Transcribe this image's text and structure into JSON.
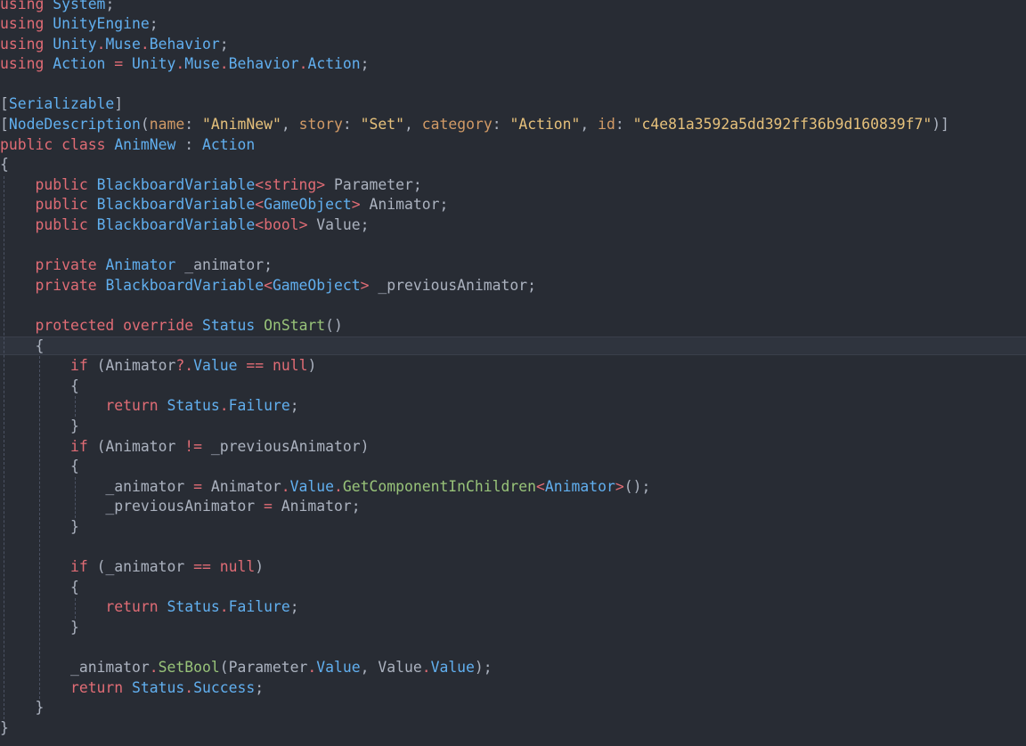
{
  "editor": {
    "lines": [
      [
        {
          "t": "using",
          "c": "kw"
        },
        {
          "t": " ",
          "c": "pn"
        },
        {
          "t": "System",
          "c": "ty"
        },
        {
          "t": ";",
          "c": "pn"
        }
      ],
      [
        {
          "t": "using",
          "c": "kw"
        },
        {
          "t": " ",
          "c": "pn"
        },
        {
          "t": "UnityEngine",
          "c": "ty"
        },
        {
          "t": ";",
          "c": "pn"
        }
      ],
      [
        {
          "t": "using",
          "c": "kw"
        },
        {
          "t": " ",
          "c": "pn"
        },
        {
          "t": "Unity",
          "c": "ty"
        },
        {
          "t": ".",
          "c": "op"
        },
        {
          "t": "Muse",
          "c": "ty"
        },
        {
          "t": ".",
          "c": "op"
        },
        {
          "t": "Behavior",
          "c": "ty"
        },
        {
          "t": ";",
          "c": "pn"
        }
      ],
      [
        {
          "t": "using",
          "c": "kw"
        },
        {
          "t": " ",
          "c": "pn"
        },
        {
          "t": "Action",
          "c": "ty"
        },
        {
          "t": " = ",
          "c": "op"
        },
        {
          "t": "Unity",
          "c": "ty"
        },
        {
          "t": ".",
          "c": "op"
        },
        {
          "t": "Muse",
          "c": "ty"
        },
        {
          "t": ".",
          "c": "op"
        },
        {
          "t": "Behavior",
          "c": "ty"
        },
        {
          "t": ".",
          "c": "op"
        },
        {
          "t": "Action",
          "c": "ty"
        },
        {
          "t": ";",
          "c": "pn"
        }
      ],
      [],
      [
        {
          "t": "[",
          "c": "pn"
        },
        {
          "t": "Serializable",
          "c": "at"
        },
        {
          "t": "]",
          "c": "pn"
        }
      ],
      [
        {
          "t": "[",
          "c": "pn"
        },
        {
          "t": "NodeDescription",
          "c": "at"
        },
        {
          "t": "(",
          "c": "pn"
        },
        {
          "t": "name",
          "c": "pm"
        },
        {
          "t": ": ",
          "c": "pn"
        },
        {
          "t": "\"AnimNew\"",
          "c": "st"
        },
        {
          "t": ", ",
          "c": "pn"
        },
        {
          "t": "story",
          "c": "pm"
        },
        {
          "t": ": ",
          "c": "pn"
        },
        {
          "t": "\"Set\"",
          "c": "st"
        },
        {
          "t": ", ",
          "c": "pn"
        },
        {
          "t": "category",
          "c": "pm"
        },
        {
          "t": ": ",
          "c": "pn"
        },
        {
          "t": "\"Action\"",
          "c": "st"
        },
        {
          "t": ", ",
          "c": "pn"
        },
        {
          "t": "id",
          "c": "pm"
        },
        {
          "t": ": ",
          "c": "pn"
        },
        {
          "t": "\"c4e81a3592a5dd392ff36b9d160839f7\"",
          "c": "st"
        },
        {
          "t": ")]",
          "c": "pn"
        }
      ],
      [
        {
          "t": "public",
          "c": "kw"
        },
        {
          "t": " ",
          "c": "pn"
        },
        {
          "t": "class",
          "c": "kw"
        },
        {
          "t": " ",
          "c": "pn"
        },
        {
          "t": "AnimNew",
          "c": "ty"
        },
        {
          "t": " : ",
          "c": "pn"
        },
        {
          "t": "Action",
          "c": "ty"
        }
      ],
      [
        {
          "t": "{",
          "c": "pn"
        }
      ],
      [
        {
          "t": "    ",
          "c": "pn"
        },
        {
          "t": "public",
          "c": "kw"
        },
        {
          "t": " ",
          "c": "pn"
        },
        {
          "t": "BlackboardVariable",
          "c": "ty"
        },
        {
          "t": "<",
          "c": "op"
        },
        {
          "t": "string",
          "c": "kw"
        },
        {
          "t": ">",
          "c": "op"
        },
        {
          "t": " Parameter;",
          "c": "pn"
        }
      ],
      [
        {
          "t": "    ",
          "c": "pn"
        },
        {
          "t": "public",
          "c": "kw"
        },
        {
          "t": " ",
          "c": "pn"
        },
        {
          "t": "BlackboardVariable",
          "c": "ty"
        },
        {
          "t": "<",
          "c": "op"
        },
        {
          "t": "GameObject",
          "c": "ty"
        },
        {
          "t": ">",
          "c": "op"
        },
        {
          "t": " Animator;",
          "c": "pn"
        }
      ],
      [
        {
          "t": "    ",
          "c": "pn"
        },
        {
          "t": "public",
          "c": "kw"
        },
        {
          "t": " ",
          "c": "pn"
        },
        {
          "t": "BlackboardVariable",
          "c": "ty"
        },
        {
          "t": "<",
          "c": "op"
        },
        {
          "t": "bool",
          "c": "kw"
        },
        {
          "t": ">",
          "c": "op"
        },
        {
          "t": " Value;",
          "c": "pn"
        }
      ],
      [],
      [
        {
          "t": "    ",
          "c": "pn"
        },
        {
          "t": "private",
          "c": "kw"
        },
        {
          "t": " ",
          "c": "pn"
        },
        {
          "t": "Animator",
          "c": "ty"
        },
        {
          "t": " _animator;",
          "c": "pn"
        }
      ],
      [
        {
          "t": "    ",
          "c": "pn"
        },
        {
          "t": "private",
          "c": "kw"
        },
        {
          "t": " ",
          "c": "pn"
        },
        {
          "t": "BlackboardVariable",
          "c": "ty"
        },
        {
          "t": "<",
          "c": "op"
        },
        {
          "t": "GameObject",
          "c": "ty"
        },
        {
          "t": ">",
          "c": "op"
        },
        {
          "t": " _previousAnimator;",
          "c": "pn"
        }
      ],
      [],
      [
        {
          "t": "    ",
          "c": "pn"
        },
        {
          "t": "protected",
          "c": "kw"
        },
        {
          "t": " ",
          "c": "pn"
        },
        {
          "t": "override",
          "c": "kw"
        },
        {
          "t": " ",
          "c": "pn"
        },
        {
          "t": "Status",
          "c": "ty"
        },
        {
          "t": " ",
          "c": "pn"
        },
        {
          "t": "OnStart",
          "c": "fn"
        },
        {
          "t": "()",
          "c": "pn"
        }
      ],
      [
        {
          "t": "    ",
          "c": "pn"
        },
        {
          "t": "{",
          "c": "pn"
        }
      ],
      [
        {
          "t": "        ",
          "c": "pn"
        },
        {
          "t": "if",
          "c": "kw"
        },
        {
          "t": " (Animator",
          "c": "pn"
        },
        {
          "t": "?.",
          "c": "op"
        },
        {
          "t": "Value",
          "c": "ty"
        },
        {
          "t": " == ",
          "c": "op"
        },
        {
          "t": "null",
          "c": "kw"
        },
        {
          "t": ")",
          "c": "pn"
        }
      ],
      [
        {
          "t": "        ",
          "c": "pn"
        },
        {
          "t": "{",
          "c": "pn"
        }
      ],
      [
        {
          "t": "            ",
          "c": "pn"
        },
        {
          "t": "return",
          "c": "kw"
        },
        {
          "t": " ",
          "c": "pn"
        },
        {
          "t": "Status",
          "c": "ty"
        },
        {
          "t": ".",
          "c": "op"
        },
        {
          "t": "Failure",
          "c": "ty"
        },
        {
          "t": ";",
          "c": "pn"
        }
      ],
      [
        {
          "t": "        ",
          "c": "pn"
        },
        {
          "t": "}",
          "c": "pn"
        }
      ],
      [
        {
          "t": "        ",
          "c": "pn"
        },
        {
          "t": "if",
          "c": "kw"
        },
        {
          "t": " (Animator ",
          "c": "pn"
        },
        {
          "t": "!=",
          "c": "op"
        },
        {
          "t": " _previousAnimator)",
          "c": "pn"
        }
      ],
      [
        {
          "t": "        ",
          "c": "pn"
        },
        {
          "t": "{",
          "c": "pn"
        }
      ],
      [
        {
          "t": "            ",
          "c": "pn"
        },
        {
          "t": "_animator ",
          "c": "pn"
        },
        {
          "t": "=",
          "c": "op"
        },
        {
          "t": " Animator",
          "c": "pn"
        },
        {
          "t": ".",
          "c": "op"
        },
        {
          "t": "Value",
          "c": "ty"
        },
        {
          "t": ".",
          "c": "op"
        },
        {
          "t": "GetComponentInChildren",
          "c": "fn"
        },
        {
          "t": "<",
          "c": "op"
        },
        {
          "t": "Animator",
          "c": "ty"
        },
        {
          "t": ">",
          "c": "op"
        },
        {
          "t": "();",
          "c": "pn"
        }
      ],
      [
        {
          "t": "            ",
          "c": "pn"
        },
        {
          "t": "_previousAnimator ",
          "c": "pn"
        },
        {
          "t": "=",
          "c": "op"
        },
        {
          "t": " Animator;",
          "c": "pn"
        }
      ],
      [
        {
          "t": "        ",
          "c": "pn"
        },
        {
          "t": "}",
          "c": "pn"
        }
      ],
      [],
      [
        {
          "t": "        ",
          "c": "pn"
        },
        {
          "t": "if",
          "c": "kw"
        },
        {
          "t": " (_animator ",
          "c": "pn"
        },
        {
          "t": "==",
          "c": "op"
        },
        {
          "t": " ",
          "c": "pn"
        },
        {
          "t": "null",
          "c": "kw"
        },
        {
          "t": ")",
          "c": "pn"
        }
      ],
      [
        {
          "t": "        ",
          "c": "pn"
        },
        {
          "t": "{",
          "c": "pn"
        }
      ],
      [
        {
          "t": "            ",
          "c": "pn"
        },
        {
          "t": "return",
          "c": "kw"
        },
        {
          "t": " ",
          "c": "pn"
        },
        {
          "t": "Status",
          "c": "ty"
        },
        {
          "t": ".",
          "c": "op"
        },
        {
          "t": "Failure",
          "c": "ty"
        },
        {
          "t": ";",
          "c": "pn"
        }
      ],
      [
        {
          "t": "        ",
          "c": "pn"
        },
        {
          "t": "}",
          "c": "pn"
        }
      ],
      [],
      [
        {
          "t": "        ",
          "c": "pn"
        },
        {
          "t": "_animator",
          "c": "pn"
        },
        {
          "t": ".",
          "c": "op"
        },
        {
          "t": "SetBool",
          "c": "fn"
        },
        {
          "t": "(Parameter",
          "c": "pn"
        },
        {
          "t": ".",
          "c": "op"
        },
        {
          "t": "Value",
          "c": "ty"
        },
        {
          "t": ", Value",
          "c": "pn"
        },
        {
          "t": ".",
          "c": "op"
        },
        {
          "t": "Value",
          "c": "ty"
        },
        {
          "t": ");",
          "c": "pn"
        }
      ],
      [
        {
          "t": "        ",
          "c": "pn"
        },
        {
          "t": "return",
          "c": "kw"
        },
        {
          "t": " ",
          "c": "pn"
        },
        {
          "t": "Status",
          "c": "ty"
        },
        {
          "t": ".",
          "c": "op"
        },
        {
          "t": "Success",
          "c": "ty"
        },
        {
          "t": ";",
          "c": "pn"
        }
      ],
      [
        {
          "t": "    ",
          "c": "pn"
        },
        {
          "t": "}",
          "c": "pn"
        }
      ],
      [
        {
          "t": "}",
          "c": "pn"
        }
      ]
    ]
  },
  "colors": {
    "background": "#282c34",
    "keyword": "#e06c75",
    "type": "#61afef",
    "function": "#98c379",
    "string": "#e5c07b",
    "parameter": "#d19a66",
    "text": "#abb2bf"
  }
}
